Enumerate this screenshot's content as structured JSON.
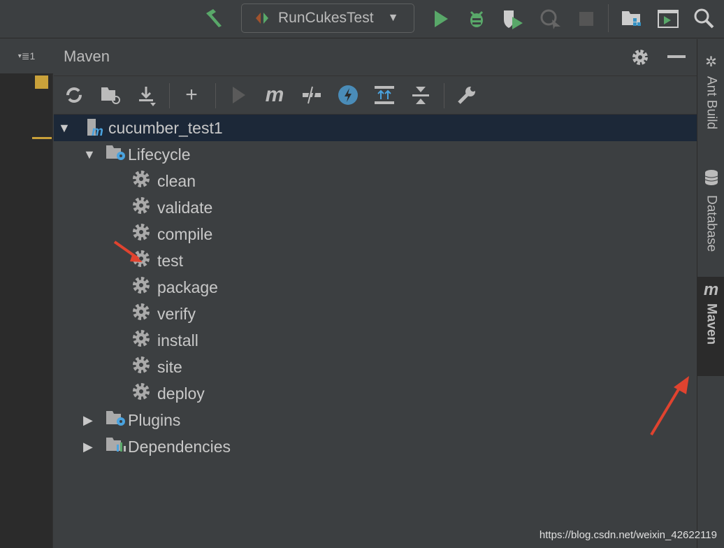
{
  "toolbar": {
    "run_config": "RunCukesTest"
  },
  "left_strip": {
    "label": "≣1"
  },
  "maven_panel": {
    "title": "Maven",
    "tree": {
      "project": "cucumber_test1",
      "lifecycle": {
        "label": "Lifecycle",
        "phases": [
          "clean",
          "validate",
          "compile",
          "test",
          "package",
          "verify",
          "install",
          "site",
          "deploy"
        ]
      },
      "plugins": "Plugins",
      "dependencies": "Dependencies"
    }
  },
  "right_sidebar": {
    "tabs": [
      {
        "label": "Ant Build"
      },
      {
        "label": "Database"
      },
      {
        "label": "Maven"
      }
    ]
  },
  "watermark": "https://blog.csdn.net/weixin_42622119",
  "colors": {
    "accent_green": "#59a869",
    "selection": "#1c2838",
    "annotation_red": "#e0432f"
  }
}
